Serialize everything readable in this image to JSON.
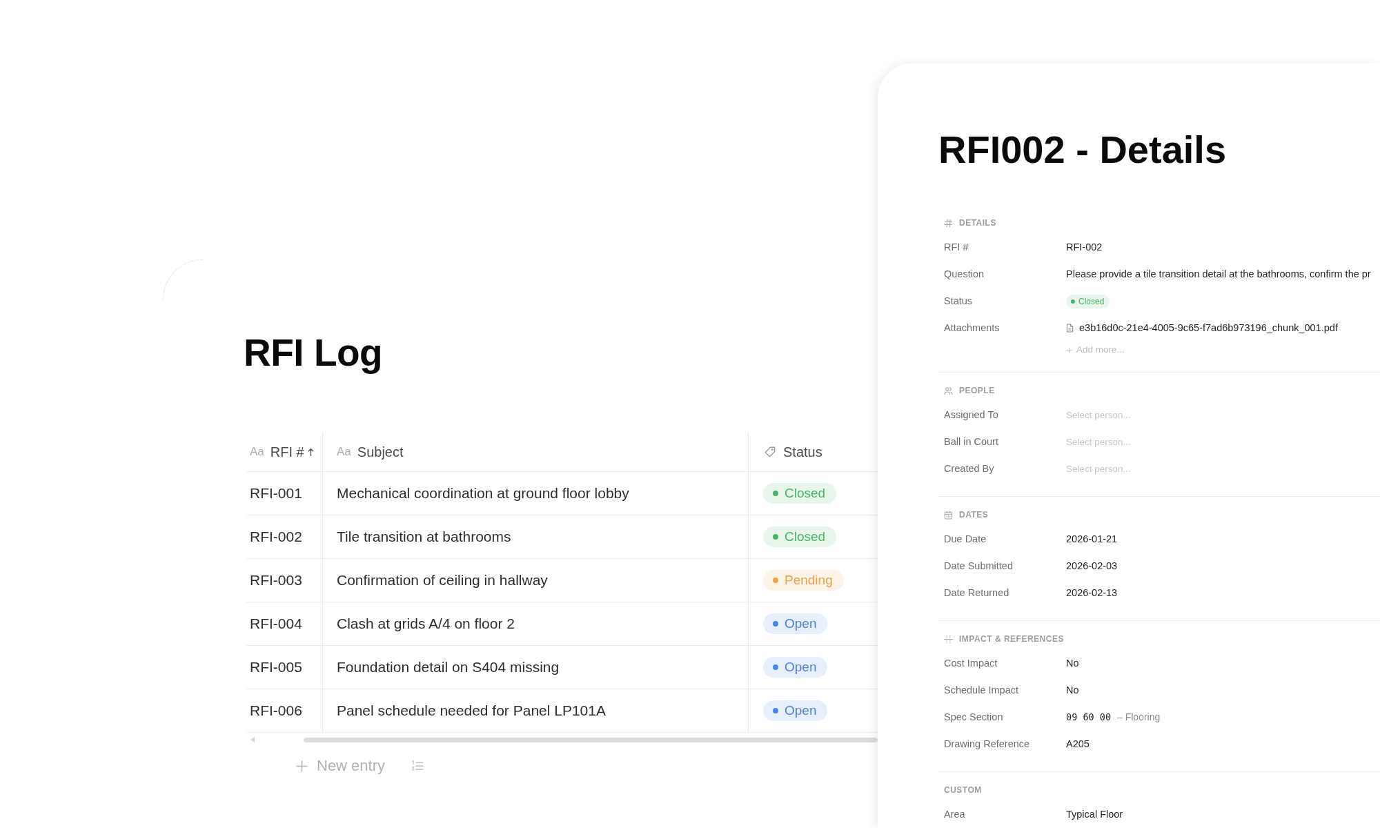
{
  "log": {
    "title": "RFI Log",
    "table": {
      "columns": [
        {
          "label": "RFI #",
          "kind": "text",
          "type_glyph": "Aa",
          "sorted": true
        },
        {
          "label": "Subject",
          "kind": "text",
          "type_glyph": "Aa",
          "sorted": false
        },
        {
          "label": "Status",
          "kind": "select",
          "sorted": false
        }
      ],
      "rows": [
        {
          "rfi": "RFI-001",
          "subject": "Mechanical coordination at ground floor lobby",
          "status": {
            "label": "Closed",
            "color": "#4cb46a"
          }
        },
        {
          "rfi": "RFI-002",
          "subject": "Tile transition at bathrooms",
          "status": {
            "label": "Closed",
            "color": "#4cb46a"
          }
        },
        {
          "rfi": "RFI-003",
          "subject": "Confirmation of ceiling in hallway",
          "status": {
            "label": "Pending",
            "color": "#eca24e"
          }
        },
        {
          "rfi": "RFI-004",
          "subject": "Clash at grids A/4 on floor 2",
          "status": {
            "label": "Open",
            "color": "#4a84e6"
          }
        },
        {
          "rfi": "RFI-005",
          "subject": "Foundation detail on S404 missing",
          "status": {
            "label": "Open",
            "color": "#4a84e6"
          }
        },
        {
          "rfi": "RFI-006",
          "subject": "Panel schedule needed for Panel LP101A",
          "status": {
            "label": "Open",
            "color": "#4a84e6"
          }
        }
      ]
    },
    "new_entry": {
      "label": "New entry"
    }
  },
  "details": {
    "title": "RFI002 - Details",
    "sections": [
      {
        "title": "DETAILS",
        "fields": [
          {
            "label": "RFI #",
            "kind": "text",
            "value": "RFI-002"
          },
          {
            "label": "Question",
            "kind": "text",
            "value": "Please provide a tile transition detail at the bathrooms, confirm the pr"
          },
          {
            "label": "Status",
            "kind": "status",
            "status": {
              "label": "Closed",
              "color": "#4cb46a"
            }
          },
          {
            "label": "Attachments",
            "kind": "files",
            "files": [
              "e3b16d0c-21e4-4005-9c65-f7ad6b973196_chunk_001.pdf"
            ],
            "add_label": "Add more..."
          }
        ]
      },
      {
        "title": "PEOPLE",
        "fields": [
          {
            "label": "Assigned To",
            "kind": "person",
            "placeholder": "Select person..."
          },
          {
            "label": "Ball in Court",
            "kind": "person",
            "placeholder": "Select person..."
          },
          {
            "label": "Created By",
            "kind": "person",
            "placeholder": "Select person..."
          }
        ]
      },
      {
        "title": "DATES",
        "fields": [
          {
            "label": "Due Date",
            "kind": "text",
            "value": "2026-01-21"
          },
          {
            "label": "Date Submitted",
            "kind": "text",
            "value": "2026-02-03"
          },
          {
            "label": "Date Returned",
            "kind": "text",
            "value": "2026-02-13"
          }
        ]
      },
      {
        "title": "IMPACT & REFERENCES",
        "fields": [
          {
            "label": "Cost Impact",
            "kind": "text",
            "value": "No"
          },
          {
            "label": "Schedule Impact",
            "kind": "text",
            "value": "No"
          },
          {
            "label": "Spec Section",
            "kind": "spec",
            "code": "09 60 00",
            "note": "– Flooring"
          },
          {
            "label": "Drawing Reference",
            "kind": "text",
            "value": "A205"
          }
        ]
      },
      {
        "title": "CUSTOM",
        "fields": [
          {
            "label": "Area",
            "kind": "text",
            "value": "Typical Floor"
          }
        ]
      }
    ]
  }
}
